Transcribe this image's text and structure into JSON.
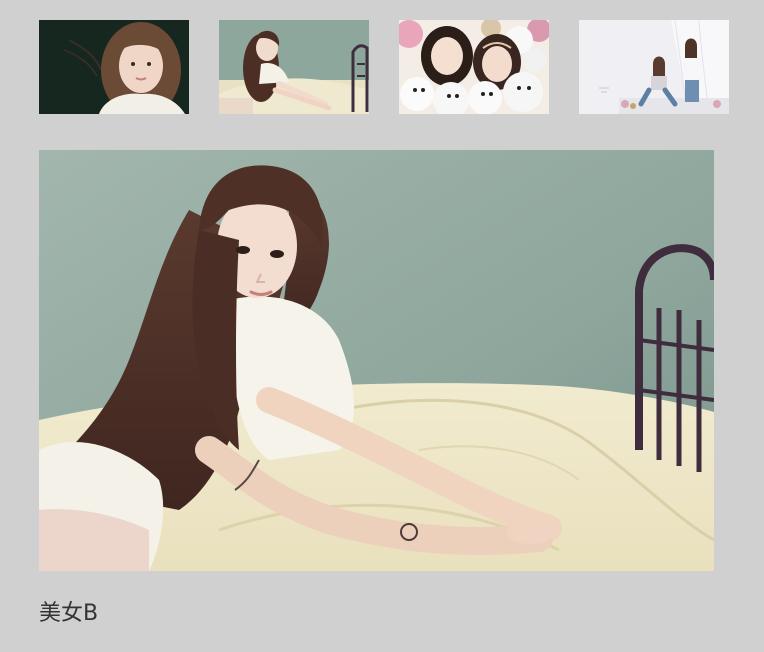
{
  "gallery": {
    "thumbnails": [
      {
        "subject": "portrait-dark-background",
        "selected": false
      },
      {
        "subject": "woman-on-bed",
        "selected": true
      },
      {
        "subject": "two-women-with-teddy-bears",
        "selected": false
      },
      {
        "subject": "two-women-in-white-room",
        "selected": false
      }
    ],
    "main_image": {
      "subject": "woman-on-bed"
    },
    "caption": "美女B"
  },
  "colors": {
    "page_background": "#d0d0d0",
    "caption_text": "#333333"
  }
}
